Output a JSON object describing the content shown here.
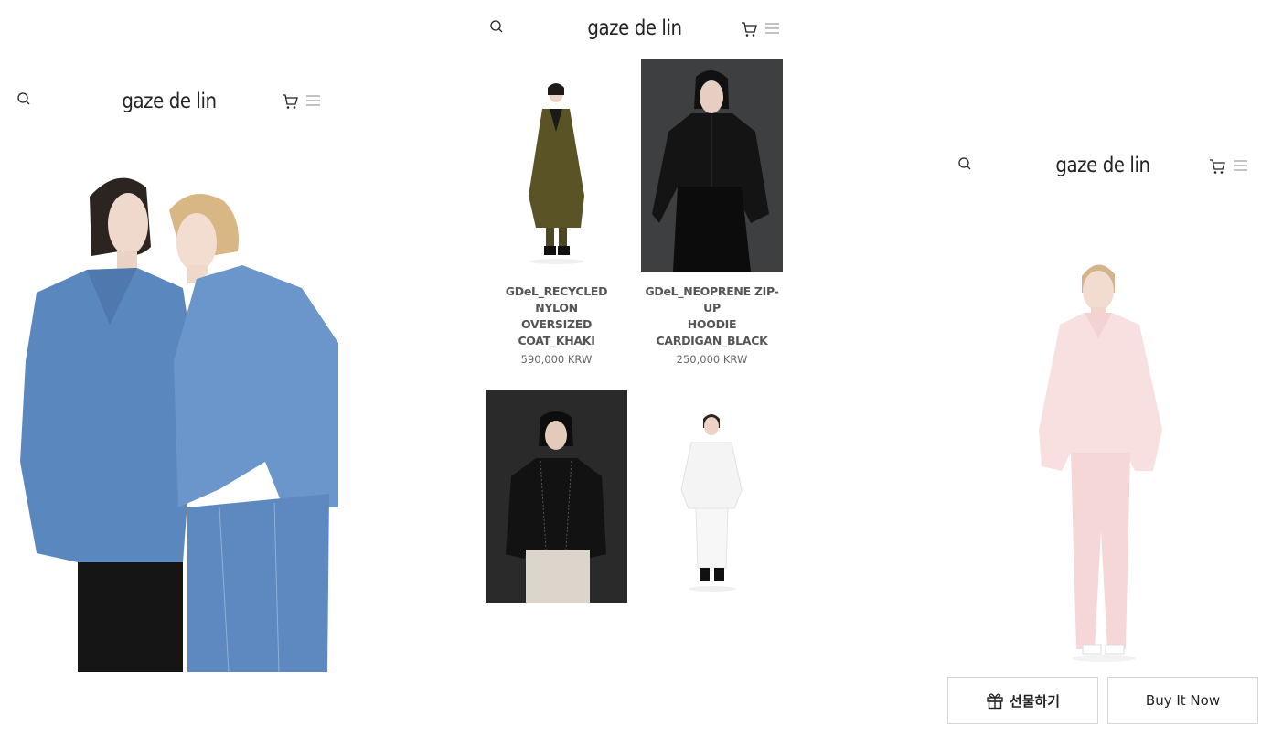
{
  "brand": {
    "logo_text": "gaze de lin"
  },
  "icons": {
    "search": "search-icon",
    "cart": "cart-icon",
    "menu": "hamburger-menu-icon",
    "gift": "gift-icon"
  },
  "left_panel": {
    "hero_alt": "Two models in blue oversized denim jackets"
  },
  "product_list": {
    "items": [
      {
        "name_line1": "GDeL_RECYCLED NYLON",
        "name_line2": "OVERSIZED",
        "name_line3": "COAT_KHAKI",
        "price": "590,000 KRW"
      },
      {
        "name_line1": "GDeL_NEOPRENE ZIP-UP",
        "name_line2": "HOODIE",
        "name_line3": "CARDIGAN_BLACK",
        "price": "250,000 KRW"
      },
      {
        "name_line1": "",
        "name_line2": "",
        "name_line3": "",
        "price": ""
      },
      {
        "name_line1": "",
        "name_line2": "",
        "name_line3": "",
        "price": ""
      }
    ]
  },
  "right_panel": {
    "gift_label": "선물하기",
    "buy_label": "Buy It Now"
  },
  "colors": {
    "background": "#ffffff",
    "text": "#333333",
    "button_border": "#d6d6d6",
    "denim": "#5b87bf",
    "khaki": "#5a5326",
    "black": "#141414",
    "pink": "#f6dcdc"
  }
}
